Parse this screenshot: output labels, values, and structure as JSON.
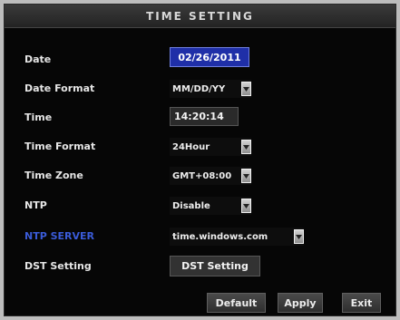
{
  "title": "TIME SETTING",
  "fields": {
    "date": {
      "label": "Date",
      "value": "02/26/2011"
    },
    "date_format": {
      "label": "Date Format",
      "value": "MM/DD/YY"
    },
    "time": {
      "label": "Time",
      "value": "14:20:14"
    },
    "time_format": {
      "label": "Time Format",
      "value": "24Hour"
    },
    "time_zone": {
      "label": "Time Zone",
      "value": "GMT+08:00"
    },
    "ntp": {
      "label": "NTP",
      "value": "Disable"
    },
    "ntp_server": {
      "label": "NTP SERVER",
      "value": "time.windows.com"
    },
    "dst": {
      "label": "DST Setting",
      "button": "DST Setting"
    }
  },
  "buttons": {
    "default": "Default",
    "apply": "Apply",
    "exit": "Exit"
  },
  "colors": {
    "background": "#060606",
    "highlight": "#1f2fa8",
    "ntp_server_label": "#3a5bd8"
  }
}
